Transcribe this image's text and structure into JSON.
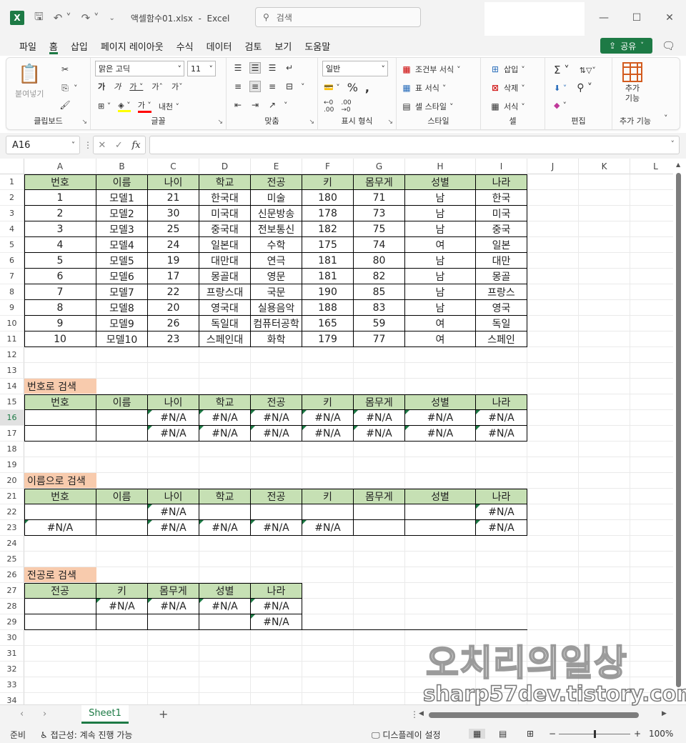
{
  "app": {
    "doc_title": "액셀함수01.xlsx",
    "app_name": "Excel",
    "search_placeholder": "검색"
  },
  "menu": {
    "tabs": [
      "파일",
      "홈",
      "삽입",
      "페이지 레이아웃",
      "수식",
      "데이터",
      "검토",
      "보기",
      "도움말"
    ],
    "active": "홈",
    "share_label": "공유"
  },
  "ribbon": {
    "clipboard": {
      "label": "클립보드",
      "paste": "붙여넣기"
    },
    "font": {
      "label": "글꼴",
      "font_name": "맑은 고딕",
      "font_size": "11"
    },
    "align": {
      "label": "맞춤"
    },
    "number": {
      "label": "표시 형식",
      "format": "일반"
    },
    "styles": {
      "label": "스타일",
      "conditional": "조건부 서식",
      "table": "표 서식",
      "cell_style": "셀 스타일"
    },
    "cells": {
      "label": "셀",
      "insert": "삽입",
      "delete": "삭제",
      "format": "서식"
    },
    "editing": {
      "label": "편집"
    },
    "addins": {
      "label": "추가 기능",
      "btn": "추가\n기능"
    }
  },
  "formula_bar": {
    "name_box": "A16",
    "formula": ""
  },
  "columns": [
    "A",
    "B",
    "C",
    "D",
    "E",
    "F",
    "G",
    "H",
    "I",
    "J",
    "K",
    "L"
  ],
  "rows": [
    "1",
    "2",
    "3",
    "4",
    "5",
    "6",
    "7",
    "8",
    "9",
    "10",
    "11",
    "12",
    "13",
    "14",
    "15",
    "16",
    "17",
    "18",
    "19",
    "20",
    "21",
    "22",
    "23",
    "24",
    "25",
    "26",
    "27",
    "28",
    "29",
    "30",
    "31",
    "32",
    "33",
    "34"
  ],
  "selected_row": "16",
  "main_table": {
    "headers": [
      "번호",
      "이름",
      "나이",
      "학교",
      "전공",
      "키",
      "몸무게",
      "성별",
      "나라"
    ],
    "rows": [
      [
        "1",
        "모델1",
        "21",
        "한국대",
        "미술",
        "180",
        "71",
        "남",
        "한국"
      ],
      [
        "2",
        "모델2",
        "30",
        "미국대",
        "신문방송",
        "178",
        "73",
        "남",
        "미국"
      ],
      [
        "3",
        "모델3",
        "25",
        "중국대",
        "전보통신",
        "182",
        "75",
        "남",
        "중국"
      ],
      [
        "4",
        "모델4",
        "24",
        "일본대",
        "수학",
        "175",
        "74",
        "여",
        "일본"
      ],
      [
        "5",
        "모델5",
        "19",
        "대만대",
        "연극",
        "181",
        "80",
        "남",
        "대만"
      ],
      [
        "6",
        "모델6",
        "17",
        "몽골대",
        "영문",
        "181",
        "82",
        "남",
        "몽골"
      ],
      [
        "7",
        "모델7",
        "22",
        "프랑스대",
        "국문",
        "190",
        "85",
        "남",
        "프랑스"
      ],
      [
        "8",
        "모델8",
        "20",
        "영국대",
        "실용음악",
        "188",
        "83",
        "남",
        "영국"
      ],
      [
        "9",
        "모델9",
        "26",
        "독일대",
        "컴퓨터공학",
        "165",
        "59",
        "여",
        "독일"
      ],
      [
        "10",
        "모델10",
        "23",
        "스페인대",
        "화학",
        "179",
        "77",
        "여",
        "스페인"
      ]
    ]
  },
  "search_by_number": {
    "title": "번호로 검색",
    "headers": [
      "번호",
      "이름",
      "나이",
      "학교",
      "전공",
      "키",
      "몸무게",
      "성별",
      "나라"
    ],
    "rows": [
      [
        "",
        "",
        "#N/A",
        "#N/A",
        "#N/A",
        "#N/A",
        "#N/A",
        "#N/A",
        "#N/A"
      ],
      [
        "",
        "",
        "#N/A",
        "#N/A",
        "#N/A",
        "#N/A",
        "#N/A",
        "#N/A",
        "#N/A"
      ]
    ]
  },
  "search_by_name": {
    "title": "이름으로 검색",
    "headers": [
      "번호",
      "이름",
      "나이",
      "학교",
      "전공",
      "키",
      "몸무게",
      "성별",
      "나라"
    ],
    "rows": [
      [
        "",
        "",
        "#N/A",
        "",
        "",
        "",
        "",
        "",
        "#N/A"
      ],
      [
        "#N/A",
        "",
        "#N/A",
        "#N/A",
        "#N/A",
        "#N/A",
        "",
        "",
        "#N/A"
      ]
    ]
  },
  "search_by_major": {
    "title": "전공로 검색",
    "headers": [
      "전공",
      "키",
      "몸무게",
      "성별",
      "나라"
    ],
    "rows": [
      [
        "",
        "#N/A",
        "#N/A",
        "#N/A",
        "#N/A"
      ],
      [
        "",
        "",
        "",
        "",
        "#N/A"
      ]
    ]
  },
  "sheets": {
    "tabs": [
      "Sheet1"
    ]
  },
  "status": {
    "ready": "준비",
    "accessibility": "접근성: 계속 진행 가능",
    "display_settings": "디스플레이 설정",
    "zoom": "100%"
  },
  "watermark": {
    "title": "오치리의일상",
    "url": "sharp57dev.tistory.com"
  }
}
